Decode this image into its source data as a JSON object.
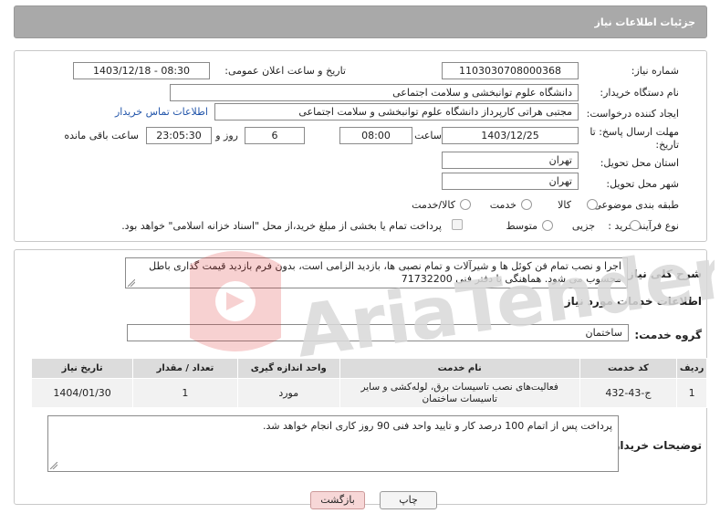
{
  "header": {
    "title": "جزئیات اطلاعات نیاز"
  },
  "fields": {
    "need_number_label": "شماره نیاز:",
    "need_number": "1103030708000368",
    "announce_label": "تاریخ و ساعت اعلان عمومی:",
    "announce_value": "1403/12/18 - 08:30",
    "buyer_org_label": "نام دستگاه خریدار:",
    "buyer_org": "دانشگاه علوم توانبخشی و سلامت اجتماعی",
    "creator_label": "ایجاد کننده درخواست:",
    "creator": "مجتبی هراتی کارپرداز دانشگاه علوم توانبخشی و سلامت اجتماعی",
    "contact_link": "اطلاعات تماس خریدار",
    "deadline_label_1": "مهلت ارسال پاسخ: تا",
    "deadline_label_2": "تاریخ:",
    "deadline_date": "1403/12/25",
    "time_label": "ساعت",
    "deadline_time": "08:00",
    "days_value": "6",
    "days_label": "روز و",
    "remaining_time": "23:05:30",
    "remaining_label": "ساعت باقی مانده",
    "province_label": "استان محل تحویل:",
    "province": "تهران",
    "city_label": "شهر محل تحویل:",
    "city": "تهران",
    "category_label": "طبقه بندی موضوعی:",
    "category_options": [
      "کالا",
      "خدمت",
      "کالا/خدمت"
    ],
    "process_label": "نوع فرآیند خرید :",
    "process_options": [
      "جزیی",
      "متوسط"
    ],
    "payment_note": "پرداخت تمام یا بخشی از مبلغ خرید،از محل \"اسناد خزانه اسلامی\" خواهد بود."
  },
  "description": {
    "label": "شرح کلی نیاز:",
    "text": "اجرا و نصب تمام فن کوئل ها و شیرآلات و تمام نصبی ها، بازدید الزامی است، بدون فرم بازدید قیمت گذاری باطل محسوب می شود. هماهنگی با دفتر فنی 71732200"
  },
  "services": {
    "section_title": "اطلاعات خدمات مورد نیاز",
    "group_label": "گروه خدمت:",
    "group_value": "ساختمان",
    "columns": [
      "ردیف",
      "کد خدمت",
      "نام خدمت",
      "واحد اندازه گیری",
      "تعداد / مقدار",
      "تاریخ نیاز"
    ],
    "rows": [
      {
        "index": "1",
        "code": "ج-43-432",
        "name": "فعالیت‌های نصب تاسیسات برق، لوله‌کشی و سایر تاسیسات ساختمان",
        "unit": "مورد",
        "qty": "1",
        "date": "1404/01/30"
      }
    ]
  },
  "buyer_notes": {
    "label": "توضیحات خریدار:",
    "text": "پرداخت پس از اتمام 100 درصد کار و تایید واحد فنی 90 روز کاری انجام خواهد شد."
  },
  "buttons": {
    "print": "چاپ",
    "back": "بازگشت"
  },
  "watermark": "AriaTender.neT",
  "colors": {
    "header_bg": "#a9a9a9",
    "link": "#2255aa",
    "back_btn_bg": "#f7d7d7",
    "print_btn_bg": "#f4f4f4"
  }
}
